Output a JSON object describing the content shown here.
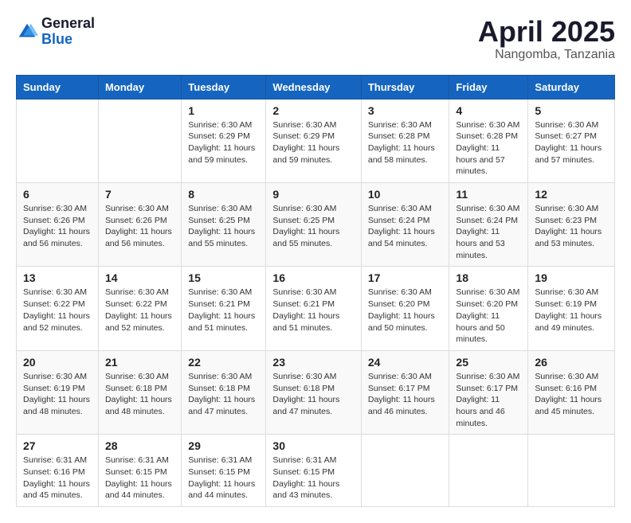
{
  "header": {
    "logo_general": "General",
    "logo_blue": "Blue",
    "month_title": "April 2025",
    "location": "Nangomba, Tanzania"
  },
  "days_of_week": [
    "Sunday",
    "Monday",
    "Tuesday",
    "Wednesday",
    "Thursday",
    "Friday",
    "Saturday"
  ],
  "weeks": [
    [
      {
        "day": "",
        "info": ""
      },
      {
        "day": "",
        "info": ""
      },
      {
        "day": "1",
        "info": "Sunrise: 6:30 AM\nSunset: 6:29 PM\nDaylight: 11 hours and 59 minutes."
      },
      {
        "day": "2",
        "info": "Sunrise: 6:30 AM\nSunset: 6:29 PM\nDaylight: 11 hours and 59 minutes."
      },
      {
        "day": "3",
        "info": "Sunrise: 6:30 AM\nSunset: 6:28 PM\nDaylight: 11 hours and 58 minutes."
      },
      {
        "day": "4",
        "info": "Sunrise: 6:30 AM\nSunset: 6:28 PM\nDaylight: 11 hours and 57 minutes."
      },
      {
        "day": "5",
        "info": "Sunrise: 6:30 AM\nSunset: 6:27 PM\nDaylight: 11 hours and 57 minutes."
      }
    ],
    [
      {
        "day": "6",
        "info": "Sunrise: 6:30 AM\nSunset: 6:26 PM\nDaylight: 11 hours and 56 minutes."
      },
      {
        "day": "7",
        "info": "Sunrise: 6:30 AM\nSunset: 6:26 PM\nDaylight: 11 hours and 56 minutes."
      },
      {
        "day": "8",
        "info": "Sunrise: 6:30 AM\nSunset: 6:25 PM\nDaylight: 11 hours and 55 minutes."
      },
      {
        "day": "9",
        "info": "Sunrise: 6:30 AM\nSunset: 6:25 PM\nDaylight: 11 hours and 55 minutes."
      },
      {
        "day": "10",
        "info": "Sunrise: 6:30 AM\nSunset: 6:24 PM\nDaylight: 11 hours and 54 minutes."
      },
      {
        "day": "11",
        "info": "Sunrise: 6:30 AM\nSunset: 6:24 PM\nDaylight: 11 hours and 53 minutes."
      },
      {
        "day": "12",
        "info": "Sunrise: 6:30 AM\nSunset: 6:23 PM\nDaylight: 11 hours and 53 minutes."
      }
    ],
    [
      {
        "day": "13",
        "info": "Sunrise: 6:30 AM\nSunset: 6:22 PM\nDaylight: 11 hours and 52 minutes."
      },
      {
        "day": "14",
        "info": "Sunrise: 6:30 AM\nSunset: 6:22 PM\nDaylight: 11 hours and 52 minutes."
      },
      {
        "day": "15",
        "info": "Sunrise: 6:30 AM\nSunset: 6:21 PM\nDaylight: 11 hours and 51 minutes."
      },
      {
        "day": "16",
        "info": "Sunrise: 6:30 AM\nSunset: 6:21 PM\nDaylight: 11 hours and 51 minutes."
      },
      {
        "day": "17",
        "info": "Sunrise: 6:30 AM\nSunset: 6:20 PM\nDaylight: 11 hours and 50 minutes."
      },
      {
        "day": "18",
        "info": "Sunrise: 6:30 AM\nSunset: 6:20 PM\nDaylight: 11 hours and 50 minutes."
      },
      {
        "day": "19",
        "info": "Sunrise: 6:30 AM\nSunset: 6:19 PM\nDaylight: 11 hours and 49 minutes."
      }
    ],
    [
      {
        "day": "20",
        "info": "Sunrise: 6:30 AM\nSunset: 6:19 PM\nDaylight: 11 hours and 48 minutes."
      },
      {
        "day": "21",
        "info": "Sunrise: 6:30 AM\nSunset: 6:18 PM\nDaylight: 11 hours and 48 minutes."
      },
      {
        "day": "22",
        "info": "Sunrise: 6:30 AM\nSunset: 6:18 PM\nDaylight: 11 hours and 47 minutes."
      },
      {
        "day": "23",
        "info": "Sunrise: 6:30 AM\nSunset: 6:18 PM\nDaylight: 11 hours and 47 minutes."
      },
      {
        "day": "24",
        "info": "Sunrise: 6:30 AM\nSunset: 6:17 PM\nDaylight: 11 hours and 46 minutes."
      },
      {
        "day": "25",
        "info": "Sunrise: 6:30 AM\nSunset: 6:17 PM\nDaylight: 11 hours and 46 minutes."
      },
      {
        "day": "26",
        "info": "Sunrise: 6:30 AM\nSunset: 6:16 PM\nDaylight: 11 hours and 45 minutes."
      }
    ],
    [
      {
        "day": "27",
        "info": "Sunrise: 6:31 AM\nSunset: 6:16 PM\nDaylight: 11 hours and 45 minutes."
      },
      {
        "day": "28",
        "info": "Sunrise: 6:31 AM\nSunset: 6:15 PM\nDaylight: 11 hours and 44 minutes."
      },
      {
        "day": "29",
        "info": "Sunrise: 6:31 AM\nSunset: 6:15 PM\nDaylight: 11 hours and 44 minutes."
      },
      {
        "day": "30",
        "info": "Sunrise: 6:31 AM\nSunset: 6:15 PM\nDaylight: 11 hours and 43 minutes."
      },
      {
        "day": "",
        "info": ""
      },
      {
        "day": "",
        "info": ""
      },
      {
        "day": "",
        "info": ""
      }
    ]
  ]
}
